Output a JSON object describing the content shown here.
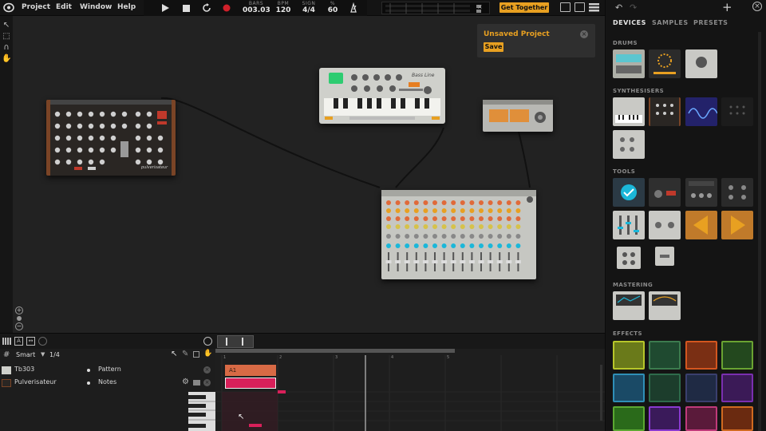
{
  "menu": [
    "Project",
    "Edit",
    "Window",
    "Help"
  ],
  "transport": {
    "bars_label": "BARS",
    "bars_value": "003.03",
    "bpm_label": "BPM",
    "bpm_value": "120",
    "sign_label": "SIGN",
    "sign_value": "4/4",
    "volume_label": "%",
    "volume_value": "60"
  },
  "header": {
    "get_together": "Get Together"
  },
  "popup": {
    "title": "Unsaved Project",
    "save": "Save",
    "close": "×"
  },
  "right_panel": {
    "tabs": [
      "DEVICES",
      "SAMPLES",
      "PRESETS"
    ],
    "sections": [
      "DRUMS",
      "SYNTHESISERS",
      "TOOLS",
      "MASTERING",
      "EFFECTS"
    ]
  },
  "devices": {
    "bassline_label": "Bass Line",
    "synth_label": "pulverisateur"
  },
  "tracks": {
    "mode": "Smart",
    "quantize": "1/4",
    "rows": [
      {
        "name": "Tb303",
        "type": "Pattern"
      },
      {
        "name": "Pulverisateur",
        "type": "Notes"
      }
    ]
  },
  "timeline": {
    "clip_label": "A1",
    "ruler": [
      "1",
      "2",
      "3",
      "4",
      "5"
    ]
  },
  "colors": {
    "accent": "#e8a021",
    "clip_pattern": "#d86a45",
    "clip_notes": "#d8205a",
    "led_cyan": "#1bb7d9"
  }
}
